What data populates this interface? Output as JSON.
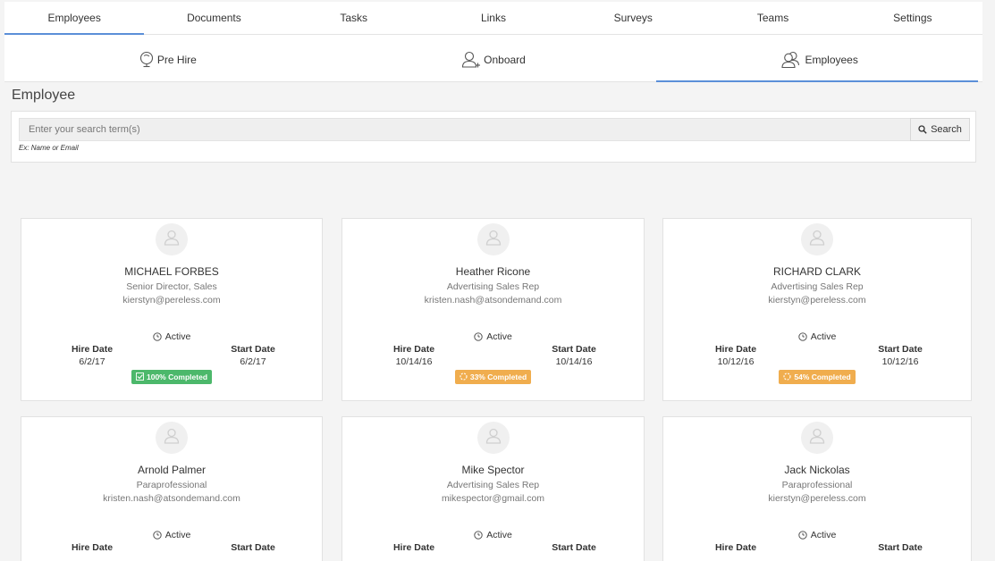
{
  "topnav": {
    "tabs": [
      {
        "label": "Employees",
        "active": true
      },
      {
        "label": "Documents",
        "active": false
      },
      {
        "label": "Tasks",
        "active": false
      },
      {
        "label": "Links",
        "active": false
      },
      {
        "label": "Surveys",
        "active": false
      },
      {
        "label": "Teams",
        "active": false
      },
      {
        "label": "Settings",
        "active": false
      }
    ]
  },
  "subnav": {
    "tabs": [
      {
        "label": "Pre Hire",
        "icon": "lightbulb-icon",
        "active": false
      },
      {
        "label": "Onboard",
        "icon": "add-user-icon",
        "active": false
      },
      {
        "label": "Employees",
        "icon": "users-icon",
        "active": true
      }
    ]
  },
  "section": {
    "title": "Employee"
  },
  "search": {
    "placeholder": "Enter your search term(s)",
    "button_label": "Search",
    "hint": "Ex: Name or Email"
  },
  "colors": {
    "accent": "#5b8fd8",
    "badge_complete": "#4cb86b",
    "badge_progress": "#f0ad4e"
  },
  "labels": {
    "hire_date": "Hire Date",
    "start_date": "Start Date"
  },
  "employees": [
    {
      "name": "MICHAEL FORBES",
      "title": "Senior Director, Sales",
      "email": "kierstyn@pereless.com",
      "status": "Active",
      "hire_date": "6/2/17",
      "start_date": "6/2/17",
      "progress": "100% Completed",
      "progress_state": "complete"
    },
    {
      "name": "Heather Ricone",
      "title": "Advertising Sales Rep",
      "email": "kristen.nash@atsondemand.com",
      "status": "Active",
      "hire_date": "10/14/16",
      "start_date": "10/14/16",
      "progress": "33% Completed",
      "progress_state": "in-progress"
    },
    {
      "name": "RICHARD CLARK",
      "title": "Advertising Sales Rep",
      "email": "kierstyn@pereless.com",
      "status": "Active",
      "hire_date": "10/12/16",
      "start_date": "10/12/16",
      "progress": "54% Completed",
      "progress_state": "in-progress"
    },
    {
      "name": "Arnold Palmer",
      "title": "Paraprofessional",
      "email": "kristen.nash@atsondemand.com",
      "status": "Active",
      "hire_date": "",
      "start_date": "",
      "progress": "",
      "progress_state": ""
    },
    {
      "name": "Mike Spector",
      "title": "Advertising Sales Rep",
      "email": "mikespector@gmail.com",
      "status": "Active",
      "hire_date": "",
      "start_date": "",
      "progress": "",
      "progress_state": ""
    },
    {
      "name": "Jack Nickolas",
      "title": "Paraprofessional",
      "email": "kierstyn@pereless.com",
      "status": "Active",
      "hire_date": "",
      "start_date": "",
      "progress": "",
      "progress_state": ""
    }
  ]
}
